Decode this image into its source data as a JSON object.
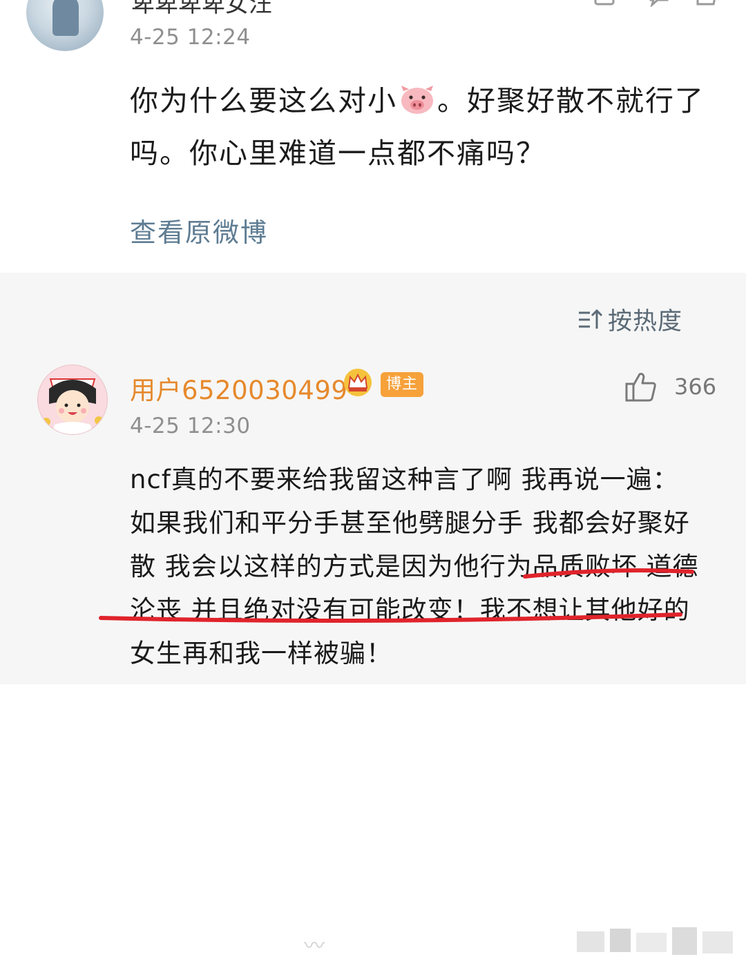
{
  "post": {
    "author": "卑卑卑卑女汪",
    "time": "4-25 12:24",
    "text_before_emoji": "你为什么要这么对小",
    "emoji_icon": "pig-face-icon",
    "text_after_emoji": "。好聚好散不就行了吗。你心里难道一点都不痛吗？",
    "view_original": "查看原微博"
  },
  "comments": {
    "sort_label": "按热度",
    "sort_icon": "sort-icon",
    "items": [
      {
        "author": "用户6520030499",
        "badge_icon": "crown-icon",
        "role_badge": "博主",
        "like_icon": "thumbs-up-icon",
        "likes": "366",
        "time": "4-25 12:30",
        "text": "ncf真的不要来给我留这种言了啊 我再说一遍：如果我们和平分手甚至他劈腿分手 我都会好聚好散 我会以这样的方式是因为他行为品质败坏 道德沦丧 并且绝对没有可能改变！我不想让其他好的女生再和我一样被骗！"
      }
    ]
  },
  "colors": {
    "author_orange": "#e6892c",
    "link_blue": "#5e7c92",
    "underline_red": "#e0232b",
    "badge_orange": "#f6a13a"
  }
}
